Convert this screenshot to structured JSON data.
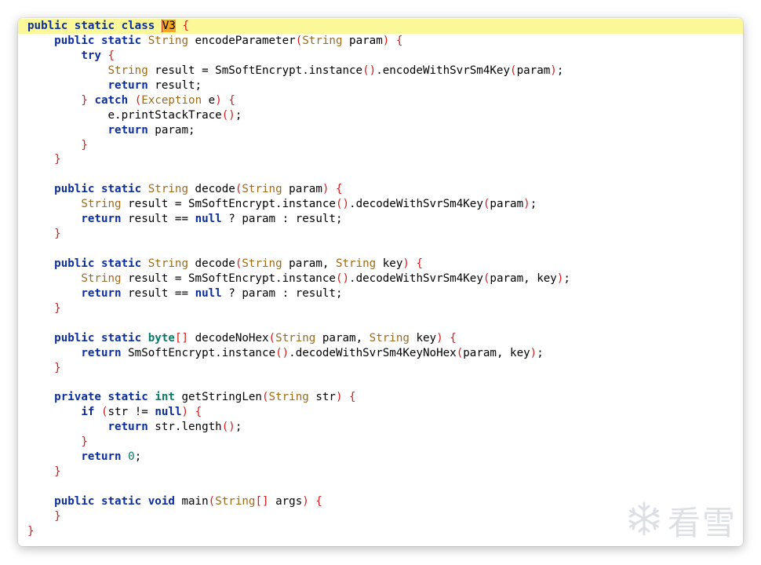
{
  "editor": {
    "language": "java",
    "highlighted_line": 1,
    "highlighted_token": "V3",
    "lines": [
      [
        {
          "t": "public",
          "c": "kw"
        },
        {
          "t": " "
        },
        {
          "t": "static",
          "c": "kw"
        },
        {
          "t": " "
        },
        {
          "t": "class",
          "c": "kw"
        },
        {
          "t": " "
        },
        {
          "t": "V3",
          "c": "cls-name"
        },
        {
          "t": " "
        },
        {
          "t": "{",
          "c": "pn"
        }
      ],
      [
        {
          "t": "    "
        },
        {
          "t": "public",
          "c": "kw"
        },
        {
          "t": " "
        },
        {
          "t": "static",
          "c": "kw"
        },
        {
          "t": " "
        },
        {
          "t": "String",
          "c": "ty"
        },
        {
          "t": " encodeParameter"
        },
        {
          "t": "(",
          "c": "pn"
        },
        {
          "t": "String",
          "c": "ty"
        },
        {
          "t": " param"
        },
        {
          "t": ")",
          "c": "pn"
        },
        {
          "t": " "
        },
        {
          "t": "{",
          "c": "pn"
        }
      ],
      [
        {
          "t": "        "
        },
        {
          "t": "try",
          "c": "kw"
        },
        {
          "t": " "
        },
        {
          "t": "{",
          "c": "pn"
        }
      ],
      [
        {
          "t": "            "
        },
        {
          "t": "String",
          "c": "ty"
        },
        {
          "t": " result = SmSoftEncrypt.instance"
        },
        {
          "t": "()",
          "c": "pn"
        },
        {
          "t": ".encodeWithSvrSm4Key"
        },
        {
          "t": "(",
          "c": "pn"
        },
        {
          "t": "param"
        },
        {
          "t": ")",
          "c": "pn"
        },
        {
          "t": ";"
        }
      ],
      [
        {
          "t": "            "
        },
        {
          "t": "return",
          "c": "kw"
        },
        {
          "t": " result;"
        }
      ],
      [
        {
          "t": "        "
        },
        {
          "t": "}",
          "c": "pn"
        },
        {
          "t": " "
        },
        {
          "t": "catch",
          "c": "kw"
        },
        {
          "t": " "
        },
        {
          "t": "(",
          "c": "pn"
        },
        {
          "t": "Exception",
          "c": "ty"
        },
        {
          "t": " e"
        },
        {
          "t": ")",
          "c": "pn"
        },
        {
          "t": " "
        },
        {
          "t": "{",
          "c": "pn"
        }
      ],
      [
        {
          "t": "            e.printStackTrace"
        },
        {
          "t": "()",
          "c": "pn"
        },
        {
          "t": ";"
        }
      ],
      [
        {
          "t": "            "
        },
        {
          "t": "return",
          "c": "kw"
        },
        {
          "t": " param;"
        }
      ],
      [
        {
          "t": "        "
        },
        {
          "t": "}",
          "c": "pn"
        }
      ],
      [
        {
          "t": "    "
        },
        {
          "t": "}",
          "c": "pn"
        }
      ],
      [],
      [
        {
          "t": "    "
        },
        {
          "t": "public",
          "c": "kw"
        },
        {
          "t": " "
        },
        {
          "t": "static",
          "c": "kw"
        },
        {
          "t": " "
        },
        {
          "t": "String",
          "c": "ty"
        },
        {
          "t": " decode"
        },
        {
          "t": "(",
          "c": "pn"
        },
        {
          "t": "String",
          "c": "ty"
        },
        {
          "t": " param"
        },
        {
          "t": ")",
          "c": "pn"
        },
        {
          "t": " "
        },
        {
          "t": "{",
          "c": "pn"
        }
      ],
      [
        {
          "t": "        "
        },
        {
          "t": "String",
          "c": "ty"
        },
        {
          "t": " result = SmSoftEncrypt.instance"
        },
        {
          "t": "()",
          "c": "pn"
        },
        {
          "t": ".decodeWithSvrSm4Key"
        },
        {
          "t": "(",
          "c": "pn"
        },
        {
          "t": "param"
        },
        {
          "t": ")",
          "c": "pn"
        },
        {
          "t": ";"
        }
      ],
      [
        {
          "t": "        "
        },
        {
          "t": "return",
          "c": "kw"
        },
        {
          "t": " result == "
        },
        {
          "t": "null",
          "c": "kw"
        },
        {
          "t": " ? param : result;"
        }
      ],
      [
        {
          "t": "    "
        },
        {
          "t": "}",
          "c": "pn"
        }
      ],
      [],
      [
        {
          "t": "    "
        },
        {
          "t": "public",
          "c": "kw"
        },
        {
          "t": " "
        },
        {
          "t": "static",
          "c": "kw"
        },
        {
          "t": " "
        },
        {
          "t": "String",
          "c": "ty"
        },
        {
          "t": " decode"
        },
        {
          "t": "(",
          "c": "pn"
        },
        {
          "t": "String",
          "c": "ty"
        },
        {
          "t": " param, "
        },
        {
          "t": "String",
          "c": "ty"
        },
        {
          "t": " key"
        },
        {
          "t": ")",
          "c": "pn"
        },
        {
          "t": " "
        },
        {
          "t": "{",
          "c": "pn"
        }
      ],
      [
        {
          "t": "        "
        },
        {
          "t": "String",
          "c": "ty"
        },
        {
          "t": " result = SmSoftEncrypt.instance"
        },
        {
          "t": "()",
          "c": "pn"
        },
        {
          "t": ".decodeWithSvrSm4Key"
        },
        {
          "t": "(",
          "c": "pn"
        },
        {
          "t": "param, key"
        },
        {
          "t": ")",
          "c": "pn"
        },
        {
          "t": ";"
        }
      ],
      [
        {
          "t": "        "
        },
        {
          "t": "return",
          "c": "kw"
        },
        {
          "t": " result == "
        },
        {
          "t": "null",
          "c": "kw"
        },
        {
          "t": " ? param : result;"
        }
      ],
      [
        {
          "t": "    "
        },
        {
          "t": "}",
          "c": "pn"
        }
      ],
      [],
      [
        {
          "t": "    "
        },
        {
          "t": "public",
          "c": "kw"
        },
        {
          "t": " "
        },
        {
          "t": "static",
          "c": "kw"
        },
        {
          "t": " "
        },
        {
          "t": "byte",
          "c": "ty-prim"
        },
        {
          "t": "[]",
          "c": "pn"
        },
        {
          "t": " decodeNoHex"
        },
        {
          "t": "(",
          "c": "pn"
        },
        {
          "t": "String",
          "c": "ty"
        },
        {
          "t": " param, "
        },
        {
          "t": "String",
          "c": "ty"
        },
        {
          "t": " key"
        },
        {
          "t": ")",
          "c": "pn"
        },
        {
          "t": " "
        },
        {
          "t": "{",
          "c": "pn"
        }
      ],
      [
        {
          "t": "        "
        },
        {
          "t": "return",
          "c": "kw"
        },
        {
          "t": " SmSoftEncrypt.instance"
        },
        {
          "t": "()",
          "c": "pn"
        },
        {
          "t": ".decodeWithSvrSm4KeyNoHex"
        },
        {
          "t": "(",
          "c": "pn"
        },
        {
          "t": "param, key"
        },
        {
          "t": ")",
          "c": "pn"
        },
        {
          "t": ";"
        }
      ],
      [
        {
          "t": "    "
        },
        {
          "t": "}",
          "c": "pn"
        }
      ],
      [],
      [
        {
          "t": "    "
        },
        {
          "t": "private",
          "c": "kw"
        },
        {
          "t": " "
        },
        {
          "t": "static",
          "c": "kw"
        },
        {
          "t": " "
        },
        {
          "t": "int",
          "c": "ty-prim"
        },
        {
          "t": " getStringLen"
        },
        {
          "t": "(",
          "c": "pn"
        },
        {
          "t": "String",
          "c": "ty"
        },
        {
          "t": " str"
        },
        {
          "t": ")",
          "c": "pn"
        },
        {
          "t": " "
        },
        {
          "t": "{",
          "c": "pn"
        }
      ],
      [
        {
          "t": "        "
        },
        {
          "t": "if",
          "c": "kw"
        },
        {
          "t": " "
        },
        {
          "t": "(",
          "c": "pn"
        },
        {
          "t": "str != "
        },
        {
          "t": "null",
          "c": "kw"
        },
        {
          "t": ")",
          "c": "pn"
        },
        {
          "t": " "
        },
        {
          "t": "{",
          "c": "pn"
        }
      ],
      [
        {
          "t": "            "
        },
        {
          "t": "return",
          "c": "kw"
        },
        {
          "t": " str.length"
        },
        {
          "t": "()",
          "c": "pn"
        },
        {
          "t": ";"
        }
      ],
      [
        {
          "t": "        "
        },
        {
          "t": "}",
          "c": "pn"
        }
      ],
      [
        {
          "t": "        "
        },
        {
          "t": "return",
          "c": "kw"
        },
        {
          "t": " "
        },
        {
          "t": "0",
          "c": "num"
        },
        {
          "t": ";"
        }
      ],
      [
        {
          "t": "    "
        },
        {
          "t": "}",
          "c": "pn"
        }
      ],
      [],
      [
        {
          "t": "    "
        },
        {
          "t": "public",
          "c": "kw"
        },
        {
          "t": " "
        },
        {
          "t": "static",
          "c": "kw"
        },
        {
          "t": " "
        },
        {
          "t": "void",
          "c": "kw"
        },
        {
          "t": " main"
        },
        {
          "t": "(",
          "c": "pn"
        },
        {
          "t": "String",
          "c": "ty"
        },
        {
          "t": "[]",
          "c": "pn"
        },
        {
          "t": " args"
        },
        {
          "t": ")",
          "c": "pn"
        },
        {
          "t": " "
        },
        {
          "t": "{",
          "c": "pn"
        }
      ],
      [
        {
          "t": "    "
        },
        {
          "t": "}",
          "c": "pn"
        }
      ],
      [
        {
          "t": "}",
          "c": "pn"
        }
      ]
    ]
  },
  "watermark": {
    "text": "看雪",
    "icon": "snowflake-icon",
    "color": "#d9dde3"
  },
  "colors": {
    "keyword": "#0b2e9e",
    "type": "#9c6a18",
    "punctuation": "#d31c1c",
    "highlight_line": "#fbf89a",
    "highlight_token": "#f5a623"
  }
}
